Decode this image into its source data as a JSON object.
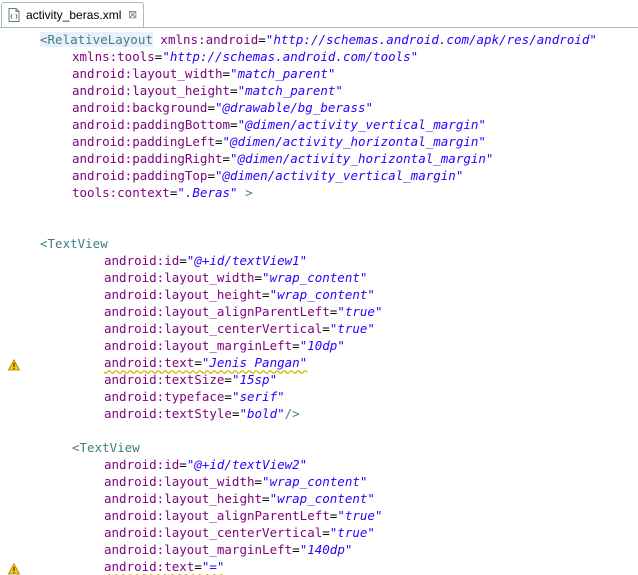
{
  "tab": {
    "label": "activity_beras.xml",
    "close_glyph": "⊠",
    "icon": "xml-file-icon"
  },
  "code": [
    {
      "indent": 40,
      "parts": [
        [
          "tag",
          "<RelativeLayout"
        ],
        [
          "sp",
          " "
        ],
        [
          "attr",
          "xmlns:android"
        ],
        [
          "eq",
          "="
        ],
        [
          "val",
          "\"http://schemas.android.com/apk/res/android\""
        ]
      ]
    },
    {
      "indent": 72,
      "parts": [
        [
          "attr",
          "xmlns:tools"
        ],
        [
          "eq",
          "="
        ],
        [
          "val",
          "\"http://schemas.android.com/tools\""
        ]
      ]
    },
    {
      "indent": 72,
      "parts": [
        [
          "attr",
          "android:layout_width"
        ],
        [
          "eq",
          "="
        ],
        [
          "val",
          "\"match_parent\""
        ]
      ]
    },
    {
      "indent": 72,
      "parts": [
        [
          "attr",
          "android:layout_height"
        ],
        [
          "eq",
          "="
        ],
        [
          "val",
          "\"match_parent\""
        ]
      ]
    },
    {
      "indent": 72,
      "parts": [
        [
          "attr",
          "android:background"
        ],
        [
          "eq",
          "="
        ],
        [
          "val",
          "\"@drawable/bg_berass\""
        ]
      ]
    },
    {
      "indent": 72,
      "parts": [
        [
          "attr",
          "android:paddingBottom"
        ],
        [
          "eq",
          "="
        ],
        [
          "val",
          "\"@dimen/activity_vertical_margin\""
        ]
      ]
    },
    {
      "indent": 72,
      "parts": [
        [
          "attr",
          "android:paddingLeft"
        ],
        [
          "eq",
          "="
        ],
        [
          "val",
          "\"@dimen/activity_horizontal_margin\""
        ]
      ]
    },
    {
      "indent": 72,
      "parts": [
        [
          "attr",
          "android:paddingRight"
        ],
        [
          "eq",
          "="
        ],
        [
          "val",
          "\"@dimen/activity_horizontal_margin\""
        ]
      ]
    },
    {
      "indent": 72,
      "parts": [
        [
          "attr",
          "android:paddingTop"
        ],
        [
          "eq",
          "="
        ],
        [
          "val",
          "\"@dimen/activity_vertical_margin\""
        ]
      ]
    },
    {
      "indent": 72,
      "parts": [
        [
          "attr",
          "tools:context"
        ],
        [
          "eq",
          "="
        ],
        [
          "val",
          "\".Beras\""
        ],
        [
          "sp",
          " "
        ],
        [
          "punct",
          ">"
        ]
      ]
    },
    {
      "indent": 40,
      "parts": []
    },
    {
      "indent": 40,
      "parts": []
    },
    {
      "indent": 40,
      "parts": [
        [
          "tag",
          "<TextView"
        ]
      ]
    },
    {
      "indent": 104,
      "parts": [
        [
          "attr",
          "android:id"
        ],
        [
          "eq",
          "="
        ],
        [
          "val",
          "\"@+id/textView1\""
        ]
      ]
    },
    {
      "indent": 104,
      "parts": [
        [
          "attr",
          "android:layout_width"
        ],
        [
          "eq",
          "="
        ],
        [
          "val",
          "\"wrap_content\""
        ]
      ]
    },
    {
      "indent": 104,
      "parts": [
        [
          "attr",
          "android:layout_height"
        ],
        [
          "eq",
          "="
        ],
        [
          "val",
          "\"wrap_content\""
        ]
      ]
    },
    {
      "indent": 104,
      "parts": [
        [
          "attr",
          "android:layout_alignParentLeft"
        ],
        [
          "eq",
          "="
        ],
        [
          "val",
          "\"true\""
        ]
      ]
    },
    {
      "indent": 104,
      "parts": [
        [
          "attr",
          "android:layout_centerVertical"
        ],
        [
          "eq",
          "="
        ],
        [
          "val",
          "\"true\""
        ]
      ]
    },
    {
      "indent": 104,
      "parts": [
        [
          "attr",
          "android:layout_marginLeft"
        ],
        [
          "eq",
          "="
        ],
        [
          "val",
          "\"10dp\""
        ]
      ]
    },
    {
      "indent": 104,
      "warn": true,
      "parts": [
        [
          "attr",
          "android:text"
        ],
        [
          "eq",
          "="
        ],
        [
          "val",
          "\"Jenis Pangan\""
        ]
      ]
    },
    {
      "indent": 104,
      "parts": [
        [
          "attr",
          "android:textSize"
        ],
        [
          "eq",
          "="
        ],
        [
          "val",
          "\"15sp\""
        ]
      ]
    },
    {
      "indent": 104,
      "parts": [
        [
          "attr",
          "android:typeface"
        ],
        [
          "eq",
          "="
        ],
        [
          "val",
          "\"serif\""
        ]
      ]
    },
    {
      "indent": 104,
      "parts": [
        [
          "attr",
          "android:textStyle"
        ],
        [
          "eq",
          "="
        ],
        [
          "val",
          "\"bold\""
        ],
        [
          "punct",
          "/>"
        ]
      ]
    },
    {
      "indent": 40,
      "parts": []
    },
    {
      "indent": 72,
      "parts": [
        [
          "tag",
          "<TextView"
        ]
      ]
    },
    {
      "indent": 104,
      "parts": [
        [
          "attr",
          "android:id"
        ],
        [
          "eq",
          "="
        ],
        [
          "val",
          "\"@+id/textView2\""
        ]
      ]
    },
    {
      "indent": 104,
      "parts": [
        [
          "attr",
          "android:layout_width"
        ],
        [
          "eq",
          "="
        ],
        [
          "val",
          "\"wrap_content\""
        ]
      ]
    },
    {
      "indent": 104,
      "parts": [
        [
          "attr",
          "android:layout_height"
        ],
        [
          "eq",
          "="
        ],
        [
          "val",
          "\"wrap_content\""
        ]
      ]
    },
    {
      "indent": 104,
      "parts": [
        [
          "attr",
          "android:layout_alignParentLeft"
        ],
        [
          "eq",
          "="
        ],
        [
          "val",
          "\"true\""
        ]
      ]
    },
    {
      "indent": 104,
      "parts": [
        [
          "attr",
          "android:layout_centerVertical"
        ],
        [
          "eq",
          "="
        ],
        [
          "val",
          "\"true\""
        ]
      ]
    },
    {
      "indent": 104,
      "parts": [
        [
          "attr",
          "android:layout_marginLeft"
        ],
        [
          "eq",
          "="
        ],
        [
          "val",
          "\"140dp\""
        ]
      ]
    },
    {
      "indent": 104,
      "warn": true,
      "parts": [
        [
          "attr",
          "android:text"
        ],
        [
          "eq",
          "="
        ],
        [
          "val",
          "\"=\""
        ]
      ]
    }
  ],
  "colors": {
    "tag": "#3f7f7f",
    "attr": "#7f007f",
    "value": "#2a00ff",
    "warning": "#e0b000"
  }
}
